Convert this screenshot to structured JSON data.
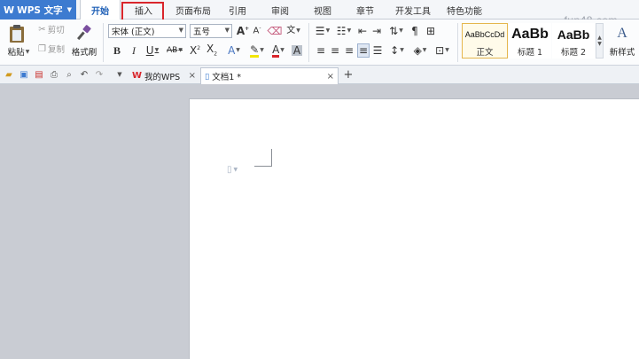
{
  "app": {
    "title": "WPS 文字",
    "logo": "W"
  },
  "menu": {
    "tabs": [
      {
        "label": "开始",
        "active": true
      },
      {
        "label": "插入",
        "highlighted": true
      },
      {
        "label": "页面布局"
      },
      {
        "label": "引用"
      },
      {
        "label": "审阅"
      },
      {
        "label": "视图"
      },
      {
        "label": "章节"
      },
      {
        "label": "开发工具"
      },
      {
        "label": "特色功能"
      }
    ]
  },
  "watermark": "fun48.com",
  "ribbon": {
    "paste_label": "粘贴",
    "cut_label": "剪切",
    "copy_label": "复制",
    "format_painter_label": "格式刷",
    "font_name": "宋体 (正文)",
    "font_size": "五号",
    "styles": [
      {
        "sample": "AaBbCcDd",
        "name": "正文",
        "selected": true
      },
      {
        "sample": "AaBb",
        "name": "标题 1"
      },
      {
        "sample": "AaBb",
        "name": "标题 2"
      }
    ],
    "new_style_label": "新样式"
  },
  "doc_tabs": [
    {
      "label": "我的WPS"
    },
    {
      "label": "文档1 *",
      "current": true
    }
  ],
  "colors": {
    "accent": "#3d7bd0",
    "highlight": "#d9262c"
  }
}
